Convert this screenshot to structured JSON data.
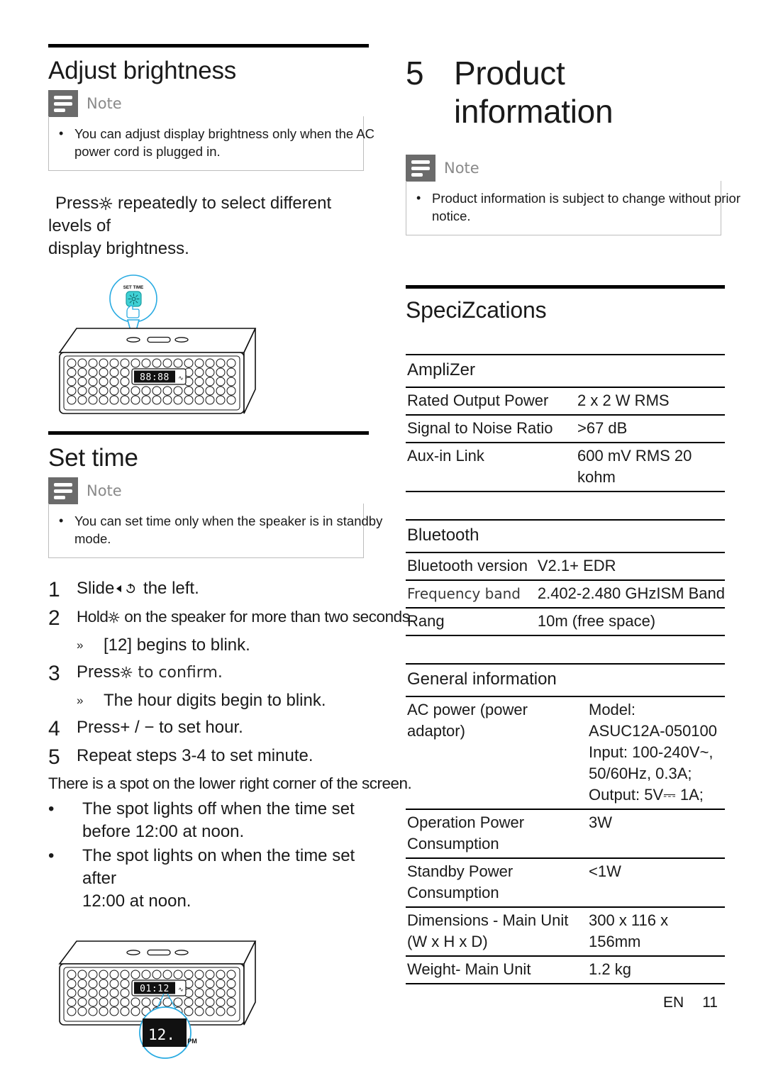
{
  "left": {
    "section1": {
      "title": "Adjust brightness",
      "note": {
        "label": "Note",
        "items": [
          "You can adjust display brightness only when the AC power cord is plugged in."
        ],
        "line1": "You can adjust display brightness only when the AC",
        "line2": "power cord is plugged in."
      },
      "paragraph_line1": "Press",
      "paragraph_icon": "brightness-icon",
      "paragraph_line1b": " repeatedly to select different levels of",
      "paragraph_line2": "display brightness."
    },
    "figure1": {
      "callout_label": "SET TIME",
      "display_value": "88:88"
    },
    "section2": {
      "title": "Set time",
      "note": {
        "label": "Note",
        "line1": "You can set time only when the speaker is in standby",
        "line2": "mode."
      },
      "steps": [
        {
          "num": "1",
          "text_a": "Slide",
          "icon": "power-icon",
          "text_b": " the left."
        },
        {
          "num": "2",
          "text_a": "Hold",
          "icon": "brightness-icon",
          "text_b": " on the speaker for more than two seconds.",
          "sub": {
            "glyph": "»",
            "text": "[12] begins to blink."
          }
        },
        {
          "num": "3",
          "text_a": "Press",
          "icon": "brightness-icon",
          "text_b": " to confirm.",
          "sub": {
            "glyph": "»",
            "text": "The hour digits begin to blink."
          }
        },
        {
          "num": "4",
          "text_a": "Press",
          "icon": "plus-minus",
          "text_b": "+ / − to set hour."
        },
        {
          "num": "5",
          "text_a": "Repeat steps 3-4 to set minute.",
          "icon": "",
          "text_b": ""
        }
      ],
      "spot_intro": "There is a spot on the lower right corner of the screen.",
      "bullets": [
        "The spot lights off when the time set before 12:00 at noon.",
        "The spot lights on when the time set after 12:00 at noon."
      ],
      "bullet1_line1": "The spot lights off when the time set",
      "bullet1_line2": "before 12:00 at noon.",
      "bullet2_line1": "The spot lights on when the time set after",
      "bullet2_line2": "12:00 at noon."
    },
    "figure2": {
      "display_value": "01:12",
      "zoom_value": "12.",
      "zoom_meridiem": "PM"
    }
  },
  "right": {
    "chapter": {
      "number": "5",
      "line1": "Product",
      "line2": "information"
    },
    "note": {
      "label": "Note",
      "line1": "Product information is subject to change without prior",
      "line2": "notice."
    },
    "specifications_title": "SpeciZcations",
    "tables": [
      {
        "heading": "AmpliZer",
        "heading_style": "normal",
        "rows": [
          {
            "key": "Rated Output Power",
            "value": "2 x 2 W RMS",
            "key_style": "normal"
          },
          {
            "key": "Signal to Noise Ratio",
            "value": ">67 dB",
            "key_style": "normal"
          },
          {
            "key": "Aux-in Link",
            "value": "600 mV RMS 20 kohm",
            "key_style": "normal"
          }
        ]
      },
      {
        "heading": "Bluetooth",
        "heading_style": "normal",
        "rows": [
          {
            "key": "Bluetooth version",
            "value": "V2.1+ EDR",
            "key_style": "normal"
          },
          {
            "key": "Frequency band",
            "value": "2.402-2.480 GHzISM Band",
            "key_style": "light"
          },
          {
            "key": "Rang",
            "value": "10m (free space)",
            "key_style": "normal"
          }
        ]
      },
      {
        "heading": "General information",
        "heading_style": "normal",
        "rows": [
          {
            "key": "AC power (power adaptor)",
            "value": "Model: ASUC12A-050100 Input: 100-240V~, 50/60Hz, 0.3A; Output: 5V⎓ 1A;",
            "key_style": "normal"
          },
          {
            "key": "Operation Power Consumption",
            "value": "3W",
            "key_style": "normal"
          },
          {
            "key": "Standby Power Consumption",
            "value": "<1W",
            "key_style": "normal"
          },
          {
            "key": "Dimensions - Main Unit (W x H x D)",
            "value": "300 x 116 x 156mm",
            "key_style": "normal"
          },
          {
            "key": "Weight- Main Unit",
            "value": "1.2 kg",
            "key_style": "normal"
          }
        ]
      }
    ],
    "general_rows_detail": {
      "ac_key_line1": "AC power (power",
      "ac_key_line2": "adaptor)",
      "ac_v1": "Model:",
      "ac_v2": "ASUC12A-050100",
      "ac_v3": "Input: 100-240V~,",
      "ac_v4": "50/60Hz, 0.3A;",
      "ac_v5": "Output: 5V⎓ 1A;",
      "op_key_line1": "Operation Power",
      "op_key_line2": "Consumption",
      "op_value": "3W",
      "sb_key_line1": "Standby Power",
      "sb_key_line2": "Consumption",
      "sb_value": "<1W",
      "dim_key_line1": "Dimensions - Main Unit",
      "dim_key_line2": "(W x H x D)",
      "dim_v1": "300 x 116 x",
      "dim_v2": "156mm",
      "wt_key": "Weight- Main Unit",
      "wt_value": "1.2 kg"
    },
    "bt_rows_detail": {
      "r1k": "Bluetooth version",
      "r1v": "V2.1+ EDR",
      "r2k": "Frequency band",
      "r2v": "2.402-2.480 GHzISM Band",
      "r3k": "Rang",
      "r3v": "10m (free space)"
    },
    "amp_rows_detail": {
      "r1k": "Rated Output Power",
      "r1v": "2 x 2 W RMS",
      "r2k": "Signal to Noise Ratio",
      "r2v": ">67 dB",
      "r3k": "Aux-in Link",
      "r3v1": "600 mV RMS 20",
      "r3v2": "kohm"
    }
  },
  "footer": {
    "lang": "EN",
    "page": "11"
  },
  "colors": {
    "note_icon_bg": "#6b6b6b",
    "note_border": "#bdbdbd",
    "accent_cyan": "#29ABE2",
    "button_teal": "#3FD0D4",
    "rule": "#000000"
  }
}
